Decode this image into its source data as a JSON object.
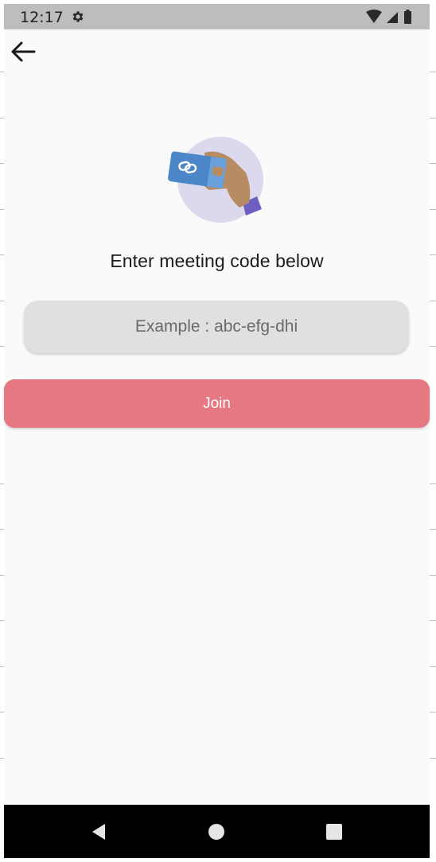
{
  "status_bar": {
    "time": "12:17",
    "settings_icon": "gear-icon",
    "wifi_icon": "wifi-icon",
    "signal_icon": "cell-signal-icon",
    "battery_icon": "battery-icon",
    "background_color": "#bdbdbd"
  },
  "toolbar": {
    "back_icon": "arrow-back-icon"
  },
  "hero": {
    "illustration": "hand-holding-link-card-illustration",
    "circle_color": "#dcd8ee",
    "card_color": "#4a86c8"
  },
  "main": {
    "heading": "Enter meeting code below",
    "code_input": {
      "value": "",
      "placeholder": "Example : abc-efg-dhi"
    },
    "join_button": {
      "label": "Join",
      "color": "#e67882"
    }
  },
  "nav_bar": {
    "back_icon": "nav-back-icon",
    "home_icon": "nav-home-icon",
    "recents_icon": "nav-recents-icon"
  }
}
